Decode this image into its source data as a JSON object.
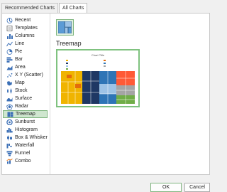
{
  "tabs": [
    {
      "label": "Recommended Charts",
      "active": false
    },
    {
      "label": "All Charts",
      "active": true
    }
  ],
  "sidebar": {
    "items": [
      {
        "label": "Recent",
        "icon": "recent-icon"
      },
      {
        "label": "Templates",
        "icon": "templates-icon"
      },
      {
        "label": "Columns",
        "icon": "columns-icon"
      },
      {
        "label": "Line",
        "icon": "line-icon"
      },
      {
        "label": "Pie",
        "icon": "pie-icon"
      },
      {
        "label": "Bar",
        "icon": "bar-icon"
      },
      {
        "label": "Area",
        "icon": "area-icon"
      },
      {
        "label": "X Y (Scatter)",
        "icon": "scatter-icon"
      },
      {
        "label": "Map",
        "icon": "map-icon"
      },
      {
        "label": "Stock",
        "icon": "stock-icon"
      },
      {
        "label": "Surface",
        "icon": "surface-icon"
      },
      {
        "label": "Radar",
        "icon": "radar-icon"
      },
      {
        "label": "Treemap",
        "icon": "treemap-icon",
        "selected": true
      },
      {
        "label": "Sunburst",
        "icon": "sunburst-icon"
      },
      {
        "label": "Histogram",
        "icon": "histogram-icon"
      },
      {
        "label": "Box & Whisker",
        "icon": "box-whisker-icon"
      },
      {
        "label": "Waterfall",
        "icon": "waterfall-icon"
      },
      {
        "label": "Funnel",
        "icon": "funnel-icon"
      },
      {
        "label": "Combo",
        "icon": "combo-icon"
      }
    ]
  },
  "main": {
    "section_title": "Treemap",
    "preview_title": "Chart Title"
  },
  "buttons": {
    "ok": "OK",
    "cancel": "Cancel"
  },
  "colors": {
    "accent": "#7fb57f",
    "selected_bg": "#cfe6cf",
    "treemap_palette": [
      "#f0b400",
      "#e46c0a",
      "#1f3864",
      "#2e75b6",
      "#9dc3e6",
      "#a5a5a5",
      "#70ad47",
      "#ff5a36"
    ]
  }
}
